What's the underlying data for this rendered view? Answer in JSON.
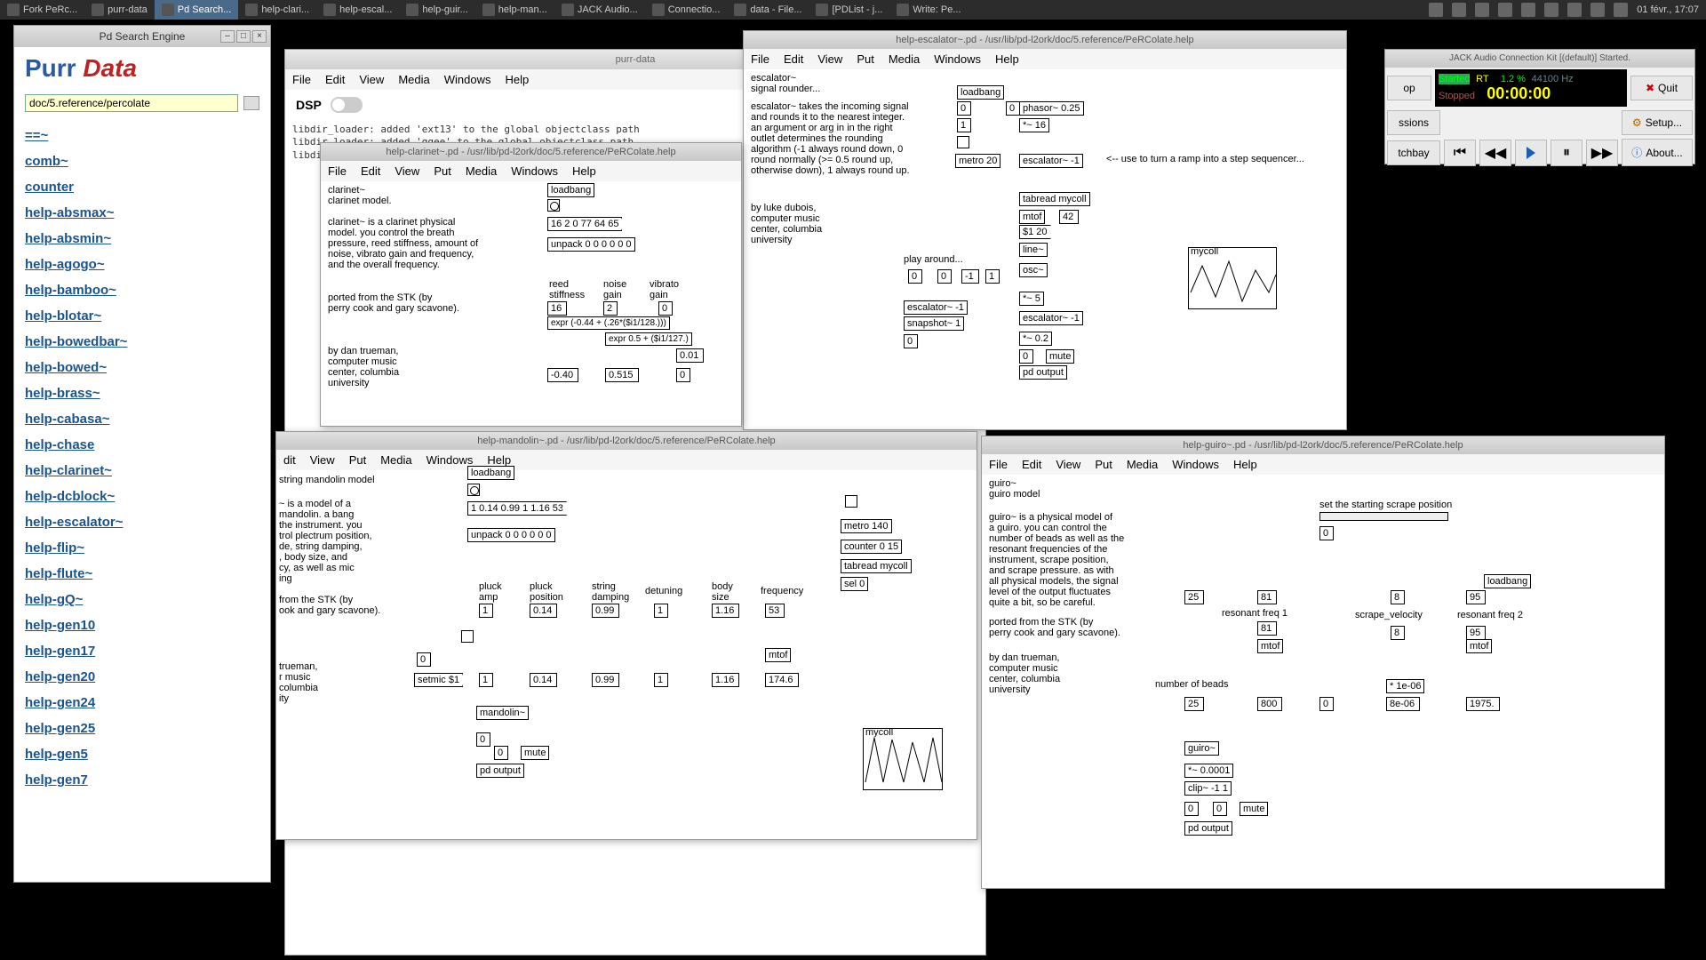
{
  "topbar": {
    "tabs": [
      {
        "label": "Fork PeRc..."
      },
      {
        "label": "purr-data"
      },
      {
        "label": "Pd Search..."
      },
      {
        "label": "help-clari..."
      },
      {
        "label": "help-escal..."
      },
      {
        "label": "help-guir..."
      },
      {
        "label": "help-man..."
      },
      {
        "label": "JACK Audio..."
      },
      {
        "label": "Connectio..."
      },
      {
        "label": "data - File..."
      },
      {
        "label": "[PDList - j..."
      },
      {
        "label": "Write: Pe..."
      }
    ],
    "clock": "01 févr., 17:07"
  },
  "search_window": {
    "title": "Pd Search Engine",
    "logo1": "Purr",
    "logo2": " Data",
    "query": "doc/5.reference/percolate",
    "results": [
      "==~",
      "comb~",
      "counter",
      "help-absmax~",
      "help-absmin~",
      "help-agogo~",
      "help-bamboo~",
      "help-blotar~",
      "help-bowedbar~",
      "help-bowed~",
      "help-brass~",
      "help-cabasa~",
      "help-chase",
      "help-clarinet~",
      "help-dcblock~",
      "help-escalator~",
      "help-flip~",
      "help-flute~",
      "help-gQ~",
      "help-gen10",
      "help-gen17",
      "help-gen20",
      "help-gen24",
      "help-gen25",
      "help-gen5",
      "help-gen7"
    ]
  },
  "pd_main": {
    "title": "purr-data",
    "menus": [
      "File",
      "Edit",
      "View",
      "Media",
      "Windows",
      "Help"
    ],
    "dsp": "DSP",
    "console": "libdir_loader: added 'ext13' to the global objectclass path\nlibdir_loader: added 'ggee' to the global objectclass path\nlibdir_loader: added 'ekext' to the global objectclass path"
  },
  "escalator": {
    "title": "help-escalator~.pd - /usr/lib/pd-l2ork/doc/5.reference/PeRColate.help",
    "menus": [
      "File",
      "Edit",
      "View",
      "Put",
      "Media",
      "Windows",
      "Help"
    ],
    "name": "escalator~",
    "subtitle": "signal rounder...",
    "desc": "escalator~ takes the incoming signal and rounds it to the nearest integer. an argument or arg in in the right outlet determines the rounding algorithm (-1 always round down, 0 round normally (>= 0.5 round up, otherwise down), 1 always round up.",
    "author": "by luke dubois,\ncomputer music\ncenter, columbia\nuniversity",
    "comment_seq": "<-- use to turn a ramp into a step sequencer...",
    "comment_play": "play around...",
    "objs": {
      "loadbang": "loadbang",
      "phasor": "phasor~ 0.25",
      "t16": "*~ 16",
      "metro20": "metro 20",
      "escalator1": "escalator~ -1",
      "tabread": "tabread mycoll",
      "snapshot": "snapshot~ 1",
      "mtof": "mtof",
      "s120": "$1 20",
      "line": "line~",
      "osc": "osc~",
      "t5": "*~ 5",
      "escalator2": "escalator~ -1",
      "t02": "*~ 0.2",
      "mute": "mute",
      "output": "pd output",
      "mycoll": "mycoll",
      "num42": "42",
      "num0": "0",
      "num1": "1",
      "numm1": "-1"
    }
  },
  "clarinet": {
    "title": "help-clarinet~.pd - /usr/lib/pd-l2ork/doc/5.reference/PeRColate.help",
    "menus": [
      "File",
      "Edit",
      "View",
      "Put",
      "Media",
      "Windows",
      "Help"
    ],
    "name": "clarinet~",
    "subtitle": "clarinet model.",
    "desc": "clarinet~ is a clarinet physical model. you control the breath pressure, reed stiffness, amount of noise, vibrato gain and frequency, and the overall frequency.",
    "port": "ported from the STK (by\nperry cook and gary scavone).",
    "author": "by dan trueman,\ncomputer music\ncenter, columbia\nuniversity",
    "objs": {
      "loadbang": "loadbang",
      "preset": "16 2 0 77 64 65",
      "unpack": "unpack 0 0 0 0 0 0",
      "reed": "reed\nstiffness",
      "noise": "noise\ngain",
      "vibrato": "vibrato\ngain",
      "n16": "16",
      "n2": "2",
      "n0": "0",
      "expr1": "expr (-0.44 + (.26*($i1/128.)))",
      "expr2": "expr 0.5 + ($i1/127.)",
      "n001": "0.01",
      "nm040": "-0.40",
      "n0515": "0.515"
    }
  },
  "mandolin": {
    "title": "help-mandolin~.pd - /usr/lib/pd-l2ork/doc/5.reference/PeRColate.help",
    "menus": [
      "dit",
      "View",
      "Put",
      "Media",
      "Windows",
      "Help"
    ],
    "name": "string mandolin model",
    "desc": "~ is a model of a\nmandolin. a bang\nthe instrument. you\ntrol plectrum position,\nde, string damping,\n, body size, and\ncy, as well as mic\ning",
    "port": "from the STK (by\nook and gary scavone).",
    "author": "trueman,\nr music\ncolumbia\nity",
    "objs": {
      "loadbang": "loadbang",
      "preset": "1 0.14 0.99 1 1.16 53",
      "unpack": "unpack 0 0 0 0 0 0",
      "metro": "metro 140",
      "counter": "counter 0 15",
      "tabread": "tabread mycoll",
      "sel": "sel 0",
      "pluckamp": "pluck\namp",
      "pluckpos": "pluck\nposition",
      "stringdamp": "string\ndamping",
      "detuning": "detuning",
      "bodysize": "body\nsize",
      "frequency": "frequency",
      "n1": "1",
      "n014": "0.14",
      "n099": "0.99",
      "n116": "1.16",
      "n53": "53",
      "setmic": "setmic $1",
      "mtof": "mtof",
      "n1746": "174.6",
      "mandolin": "mandolin~",
      "mute": "mute",
      "output": "pd output",
      "mycoll": "mycoll",
      "n0": "0"
    }
  },
  "guiro": {
    "title": "help-guiro~.pd - /usr/lib/pd-l2ork/doc/5.reference/PeRColate.help",
    "menus": [
      "File",
      "Edit",
      "View",
      "Put",
      "Media",
      "Windows",
      "Help"
    ],
    "name": "guiro~",
    "subtitle": "guiro model",
    "desc": "guiro~ is a physical model of\na guiro. you can control the\nnumber of beads as well as the\nresonant frequencies of the\ninstrument, scrape position,\nand scrape pressure. as with\nall physical models, the signal\nlevel of the output fluctuates\nquite a bit, so be careful.",
    "port": "ported from the STK (by\nperry cook and gary scavone).",
    "author": "by dan trueman,\ncomputer music\ncenter, columbia\nuniversity",
    "set_pos": "set the starting scrape position",
    "objs": {
      "loadbang": "loadbang",
      "rf1": "resonant freq 1",
      "rf2": "resonant freq 2",
      "scrape": "scrape_velocity",
      "beads": "number of beads",
      "n25": "25",
      "n81": "81",
      "n8": "8",
      "n95": "95",
      "n800": "800",
      "n0": "0",
      "n8e06": "8e-06",
      "n1975": "1975.",
      "t1e06": "* 1e-06",
      "mtof": "mtof",
      "guiro": "guiro~",
      "t00001": "*~ 0.0001",
      "clip": "clip~ -1 1",
      "mute": "mute",
      "output": "pd output"
    }
  },
  "jack": {
    "title": "JACK Audio Connection Kit [(default)] Started.",
    "started": "Started",
    "rt": "RT",
    "pct": "1.2 %",
    "rate": "44100 Hz",
    "stopped": "Stopped",
    "time": "00:00:00",
    "quit": "Quit",
    "setup": "Setup...",
    "about": "About...",
    "patchbay": "tchbay",
    "sess": "ssions",
    "stop_side": "op"
  }
}
